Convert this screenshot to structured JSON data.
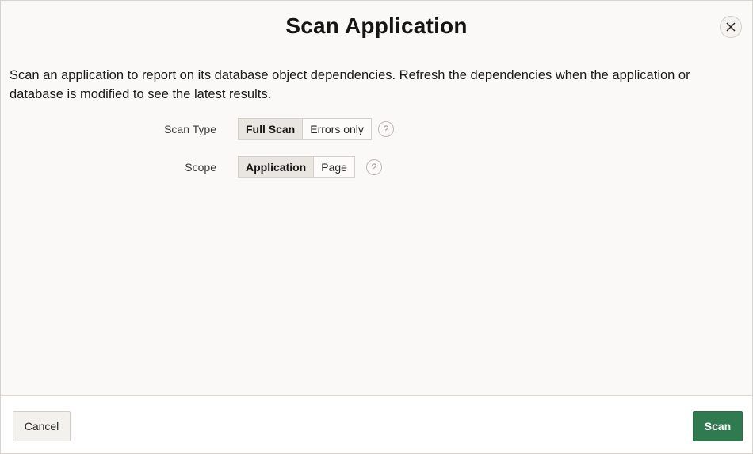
{
  "dialog": {
    "title": "Scan Application",
    "close_icon": "close-icon"
  },
  "body": {
    "description": "Scan an application to report on its database object dependencies. Refresh the dependencies when the application or database is modified to see the latest results.",
    "scan_type": {
      "label": "Scan Type",
      "options": [
        "Full Scan",
        "Errors only"
      ],
      "selected": "Full Scan",
      "help_icon": "?"
    },
    "scope": {
      "label": "Scope",
      "options": [
        "Application",
        "Page"
      ],
      "selected": "Application",
      "help_icon": "?"
    }
  },
  "footer": {
    "cancel_label": "Cancel",
    "scan_label": "Scan"
  },
  "colors": {
    "primary_button": "#2f7a4e",
    "background": "#faf9f7"
  }
}
